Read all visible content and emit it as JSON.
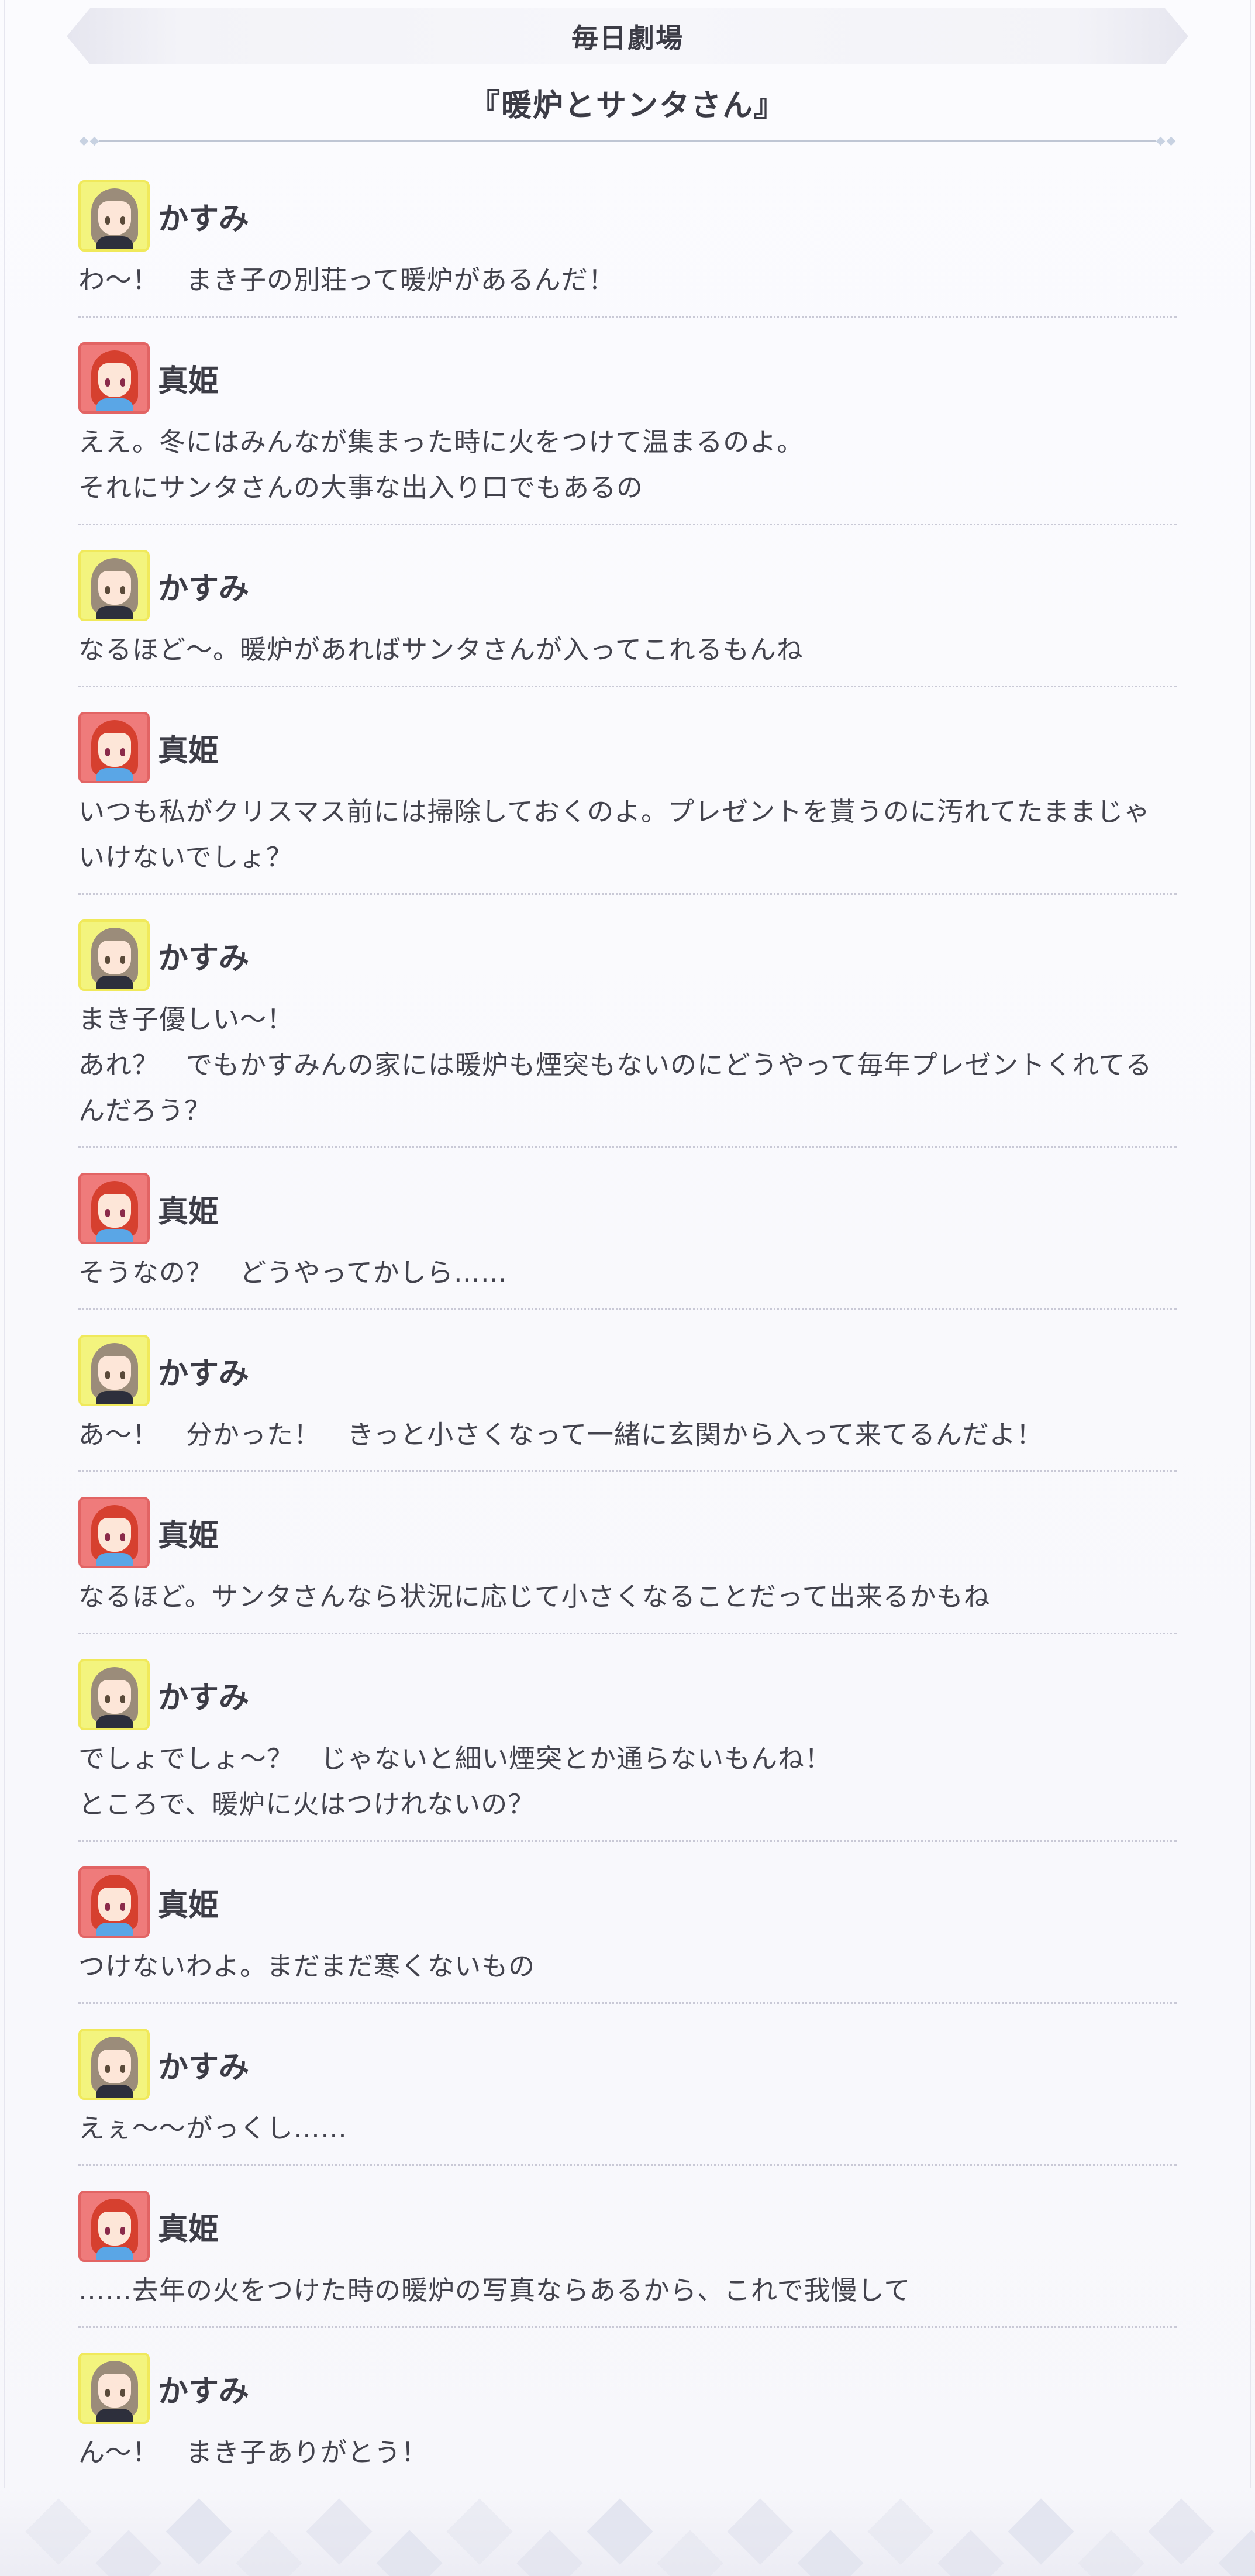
{
  "header": {
    "title": "毎日劇場"
  },
  "story": {
    "title": "『暖炉とサンタさん』"
  },
  "dialogue": [
    {
      "speaker": "かすみ",
      "avatar": "kasumi-avatar",
      "lines": [
        "わ〜！　まき子の別荘って暖炉があるんだ！"
      ]
    },
    {
      "speaker": "真姫",
      "avatar": "maki-avatar",
      "lines": [
        "ええ。冬にはみんなが集まった時に火をつけて温まるのよ。",
        "それにサンタさんの大事な出入り口でもあるの"
      ]
    },
    {
      "speaker": "かすみ",
      "avatar": "kasumi-avatar",
      "lines": [
        "なるほど〜。暖炉があればサンタさんが入ってこれるもんね"
      ]
    },
    {
      "speaker": "真姫",
      "avatar": "maki-avatar",
      "lines": [
        "いつも私がクリスマス前には掃除しておくのよ。プレゼントを貰うのに汚れてたままじゃ",
        "いけないでしょ？"
      ]
    },
    {
      "speaker": "かすみ",
      "avatar": "kasumi-avatar",
      "lines": [
        "まき子優しい〜！",
        "あれ？　でもかすみんの家には暖炉も煙突もないのにどうやって毎年プレゼントくれてる",
        "んだろう？"
      ]
    },
    {
      "speaker": "真姫",
      "avatar": "maki-avatar",
      "lines": [
        "そうなの？　どうやってかしら……"
      ]
    },
    {
      "speaker": "かすみ",
      "avatar": "kasumi-avatar",
      "lines": [
        "あ〜！　分かった！　きっと小さくなって一緒に玄関から入って来てるんだよ！"
      ]
    },
    {
      "speaker": "真姫",
      "avatar": "maki-avatar",
      "lines": [
        "なるほど。サンタさんなら状況に応じて小さくなることだって出来るかもね"
      ]
    },
    {
      "speaker": "かすみ",
      "avatar": "kasumi-avatar",
      "lines": [
        "でしょでしょ〜？　じゃないと細い煙突とか通らないもんね！",
        "ところで、暖炉に火はつけれないの？"
      ]
    },
    {
      "speaker": "真姫",
      "avatar": "maki-avatar",
      "lines": [
        "つけないわよ。まだまだ寒くないもの"
      ]
    },
    {
      "speaker": "かすみ",
      "avatar": "kasumi-avatar",
      "lines": [
        "えぇ〜〜がっくし……"
      ]
    },
    {
      "speaker": "真姫",
      "avatar": "maki-avatar",
      "lines": [
        "……去年の火をつけた時の暖炉の写真ならあるから、これで我慢して"
      ]
    },
    {
      "speaker": "かすみ",
      "avatar": "kasumi-avatar",
      "lines": [
        "ん〜！　まき子ありがとう！"
      ]
    }
  ]
}
